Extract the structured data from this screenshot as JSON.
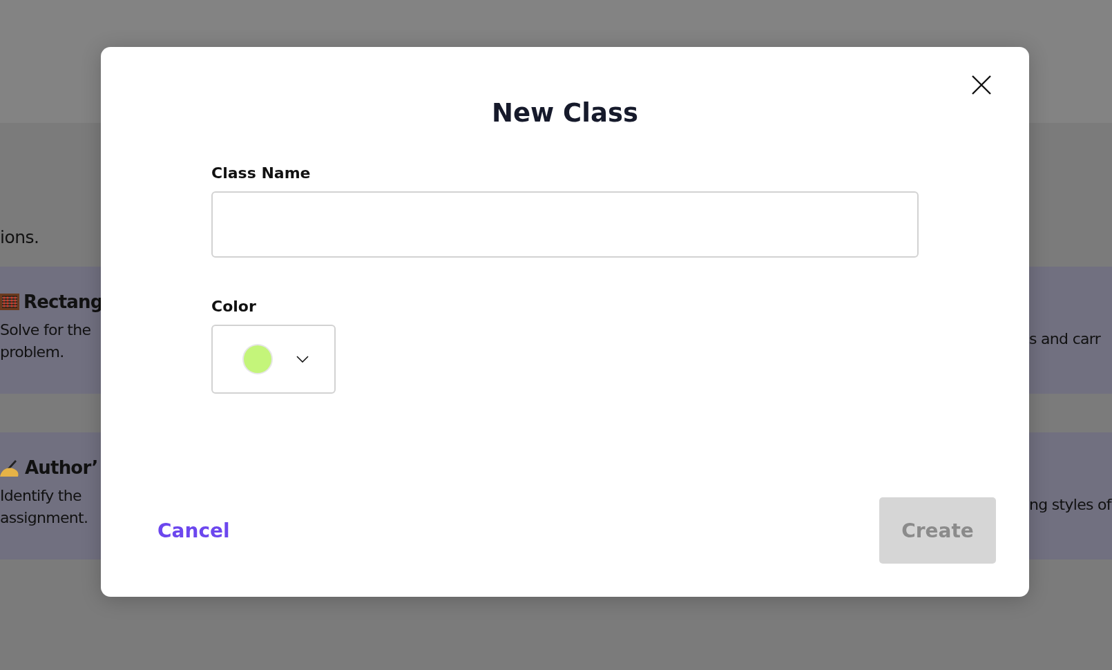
{
  "background": {
    "intro_text": "ions.",
    "cards": [
      {
        "kind": "abacus",
        "title": "Rectang",
        "description_left": [
          "Solve for the",
          "problem."
        ],
        "description_right": "s and carr"
      },
      {
        "kind": "writing",
        "title": "Author’",
        "description_left": [
          "Identify the",
          "assignment."
        ],
        "description_right": "ng styles of"
      }
    ]
  },
  "dialog": {
    "title": "New Class",
    "fields": [
      {
        "kind": "text",
        "label": "Class Name"
      },
      {
        "kind": "color",
        "label": "Color",
        "color": "#c4f57a"
      }
    ],
    "cancel": "Cancel",
    "create": {
      "label": "Create",
      "disabled": true
    }
  }
}
